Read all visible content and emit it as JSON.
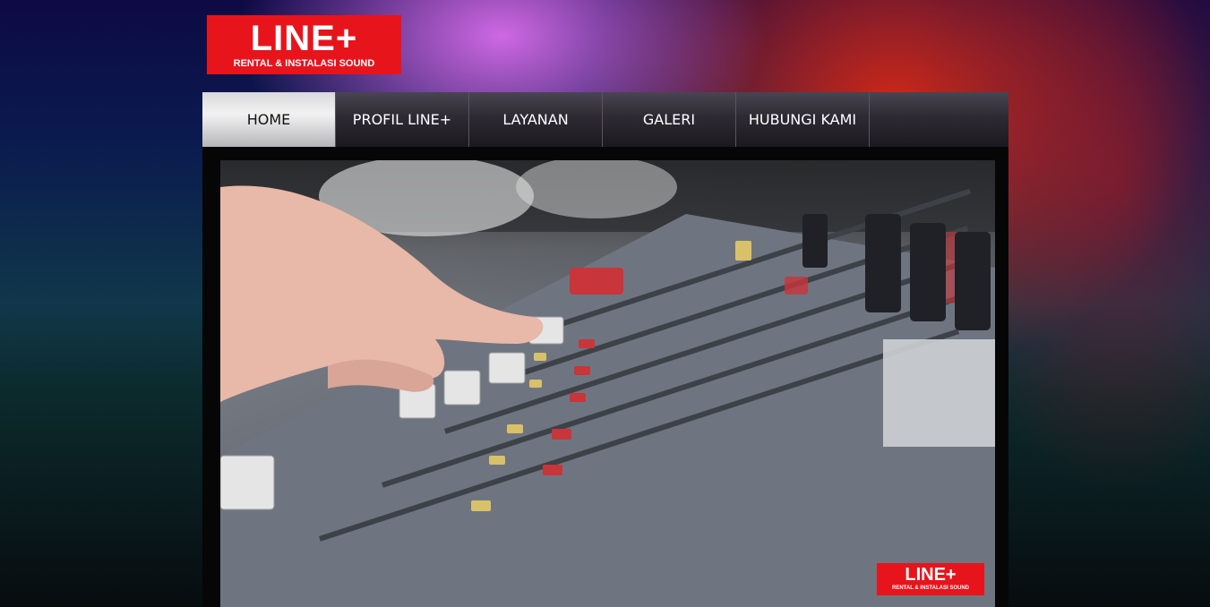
{
  "brand": {
    "logo_text": "LINE+",
    "tagline": "RENTAL & INSTALASI SOUND",
    "color": "#e8141c"
  },
  "nav": {
    "items": [
      {
        "label": "HOME",
        "active": true
      },
      {
        "label": "PROFIL LINE+",
        "active": false
      },
      {
        "label": "LAYANAN",
        "active": false
      },
      {
        "label": "GALERI",
        "active": false
      },
      {
        "label": "HUBUNGI KAMI",
        "active": false
      }
    ]
  },
  "hero": {
    "image_subject": "mixing-console",
    "watermark_text": "LINE+",
    "watermark_tagline": "RENTAL & INSTALASI SOUND"
  }
}
